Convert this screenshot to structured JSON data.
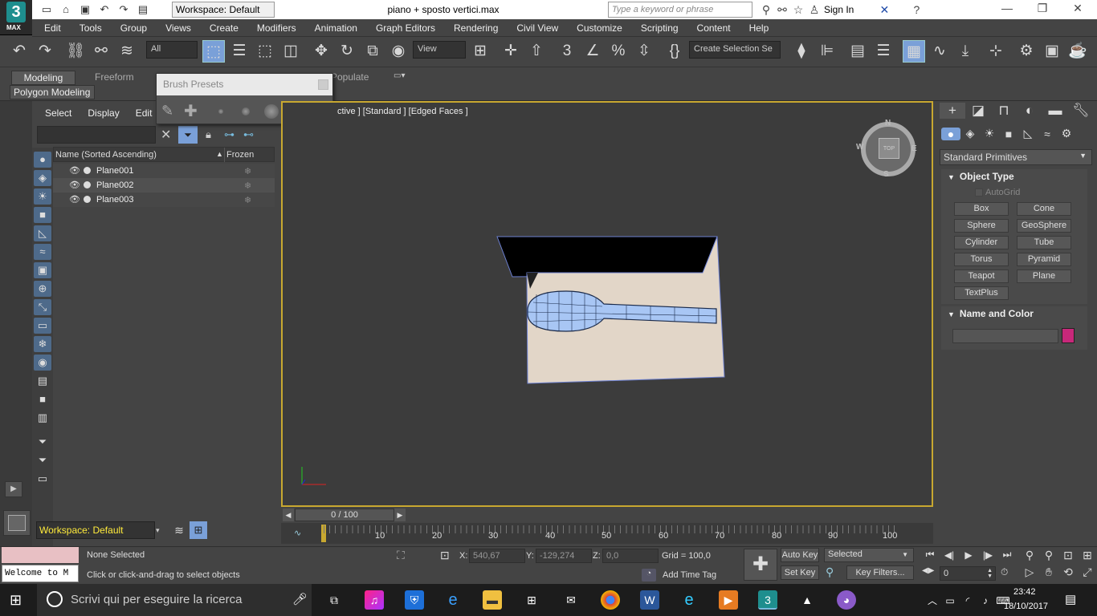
{
  "app": {
    "logo_number": "3",
    "logo_text": "MAX"
  },
  "titlebar": {
    "workspace": "Workspace: Default",
    "document_title": "piano + sposto vertici.max",
    "search_placeholder": "Type a keyword or phrase",
    "sign_in": "Sign In"
  },
  "menu": [
    "Edit",
    "Tools",
    "Group",
    "Views",
    "Create",
    "Modifiers",
    "Animation",
    "Graph Editors",
    "Rendering",
    "Civil View",
    "Customize",
    "Scripting",
    "Content",
    "Help"
  ],
  "toolbar": {
    "selection_filter": "All",
    "ref_coord": "View",
    "named_selection": "Create Selection Se"
  },
  "ribbon": {
    "tabs": [
      "Modeling",
      "Freeform",
      "Populate"
    ],
    "active_panel": "Polygon Modeling"
  },
  "brush_presets": {
    "title": "Brush Presets"
  },
  "scene_explorer": {
    "menus": [
      "Select",
      "Display",
      "Edit"
    ],
    "columns": {
      "name": "Name (Sorted Ascending)",
      "frozen": "Frozen"
    },
    "rows": [
      {
        "name": "Plane001"
      },
      {
        "name": "Plane002"
      },
      {
        "name": "Plane003"
      }
    ],
    "workspace": "Workspace: Default"
  },
  "viewport": {
    "label": "ctive ] [Standard ] [Edged Faces ]",
    "viewcube": {
      "face": "TOP",
      "n": "N",
      "s": "S",
      "e": "E",
      "w": "W"
    }
  },
  "timeline": {
    "frame_display": "0 / 100",
    "ticks": [
      "10",
      "20",
      "30",
      "40",
      "50",
      "60",
      "70",
      "80",
      "90",
      "100"
    ]
  },
  "command_panel": {
    "category": "Standard Primitives",
    "object_type_title": "Object Type",
    "autogrid": "AutoGrid",
    "buttons": [
      "Box",
      "Cone",
      "Sphere",
      "GeoSphere",
      "Cylinder",
      "Tube",
      "Torus",
      "Pyramid",
      "Teapot",
      "Plane",
      "TextPlus"
    ],
    "name_color_title": "Name and Color",
    "color": "#c8287a"
  },
  "status": {
    "maxscript_listener": "Welcome to M",
    "selection": "None Selected",
    "prompt": "Click or click-and-drag to select objects",
    "x_label": "X:",
    "x_value": "540,67",
    "y_label": "Y:",
    "y_value": "-129,274",
    "z_label": "Z:",
    "z_value": "0,0",
    "grid": "Grid = 100,0",
    "add_time_tag": "Add Time Tag",
    "auto_key": "Auto Key",
    "selected": "Selected",
    "set_key": "Set Key",
    "key_filters": "Key Filters...",
    "frame": "0"
  },
  "taskbar": {
    "search_placeholder": "Scrivi qui per eseguire la ricerca",
    "time": "23:42",
    "date": "18/10/2017"
  }
}
